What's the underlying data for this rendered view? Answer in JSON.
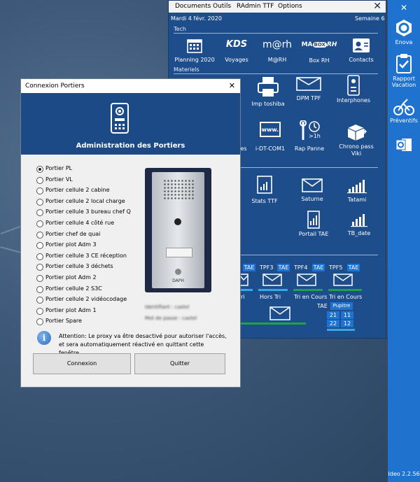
{
  "menu": {
    "documents": "Documents",
    "outils": "Outils",
    "radmin": "RAdmin TTF",
    "options": "Options",
    "close": "✕"
  },
  "header": {
    "date": "Mardi 4 févr. 2020",
    "week": "Semaine 6"
  },
  "sections": {
    "tech": "Tech",
    "materiels": "Materiels"
  },
  "tech_tiles": [
    {
      "label": "Planning 2020"
    },
    {
      "label": "Voyages"
    },
    {
      "label": "M@RH"
    },
    {
      "label": "Box RH"
    },
    {
      "label": "Contacts"
    }
  ],
  "logos": {
    "kds": "KDS",
    "marh": "m@rh",
    "maboxrh_1": "MA",
    "maboxrh_2": "BOX",
    "maboxrh_3": "RH",
    "www": "www."
  },
  "materiels_row1": [
    {
      "label": "Imp toshiba"
    },
    {
      "label": "DPM TPF"
    },
    {
      "label": "Interphones"
    }
  ],
  "materiels_row2": [
    {
      "label": "es"
    },
    {
      "label": "i-DT-COM1"
    },
    {
      "label": "Rap Panne"
    },
    {
      "label": "Chrono pass Viki"
    }
  ],
  "clock_text": ">1h",
  "stats_row1": [
    {
      "label": "Stats TTF"
    },
    {
      "label": "Saturne"
    },
    {
      "label": "Tatami"
    }
  ],
  "stats_row2": [
    {
      "label": "Portail TAE"
    },
    {
      "label": "TB_date"
    }
  ],
  "tpf": {
    "labels": [
      "TAE",
      "TPF3",
      "TAE",
      "TPF4",
      "TAE",
      "TPF5",
      "TAE"
    ],
    "row2": [
      "rri",
      "Hors Tri",
      "Tri en Cours",
      "Tri en Cours"
    ],
    "tae": "TAE",
    "pupitre": "Pupitre",
    "nums": [
      "21",
      "11",
      "22",
      "12"
    ]
  },
  "sidebar": {
    "close": "✕",
    "items": [
      {
        "label": "Enova"
      },
      {
        "label": "Rapport Vacation"
      },
      {
        "label": "Préventifs"
      },
      {
        "label": ""
      }
    ],
    "version": "Ideo 2.2.56"
  },
  "dialog": {
    "title": "Connexion Portiers",
    "close": "✕",
    "heading": "Administration des Portiers",
    "options": [
      {
        "label": "Portier PL",
        "selected": true
      },
      {
        "label": "Portier VL",
        "selected": false
      },
      {
        "label": "Portier cellule 2 cabine",
        "selected": false
      },
      {
        "label": "Portier cellule 2 local charge",
        "selected": false
      },
      {
        "label": "Portier cellule 3 bureau chef Q",
        "selected": false
      },
      {
        "label": "Portier cellule 4 côté rue",
        "selected": false
      },
      {
        "label": "Portier chef de quai",
        "selected": false
      },
      {
        "label": "Portier plot Adm 3",
        "selected": false
      },
      {
        "label": "Portier cellule 3 CE réception",
        "selected": false
      },
      {
        "label": "Portier cellule 3 déchets",
        "selected": false
      },
      {
        "label": "Portier plot Adm 2",
        "selected": false
      },
      {
        "label": "Portier cellule 2 S3C",
        "selected": false
      },
      {
        "label": "Portier cellule 2 vidéocodage",
        "selected": false
      },
      {
        "label": "Portier plot Adm 1",
        "selected": false
      },
      {
        "label": "Portier Spare",
        "selected": false
      }
    ],
    "intercom_label": "DAPH",
    "identifiant": "Identifiant : castel",
    "motdepasse": "Mot de passe : castel",
    "attention": "Attention: Le proxy va être desactivé pour autoriser l'accès, et sera automatiquement réactivé en quittant cette fenêtre.",
    "connexion": "Connexion",
    "quitter": "Quitter"
  },
  "colors": {
    "app_bg": "#1e4d8c",
    "sidebar": "#1f73cf",
    "dialog_header": "#1b4a86",
    "green": "#22a14a"
  }
}
